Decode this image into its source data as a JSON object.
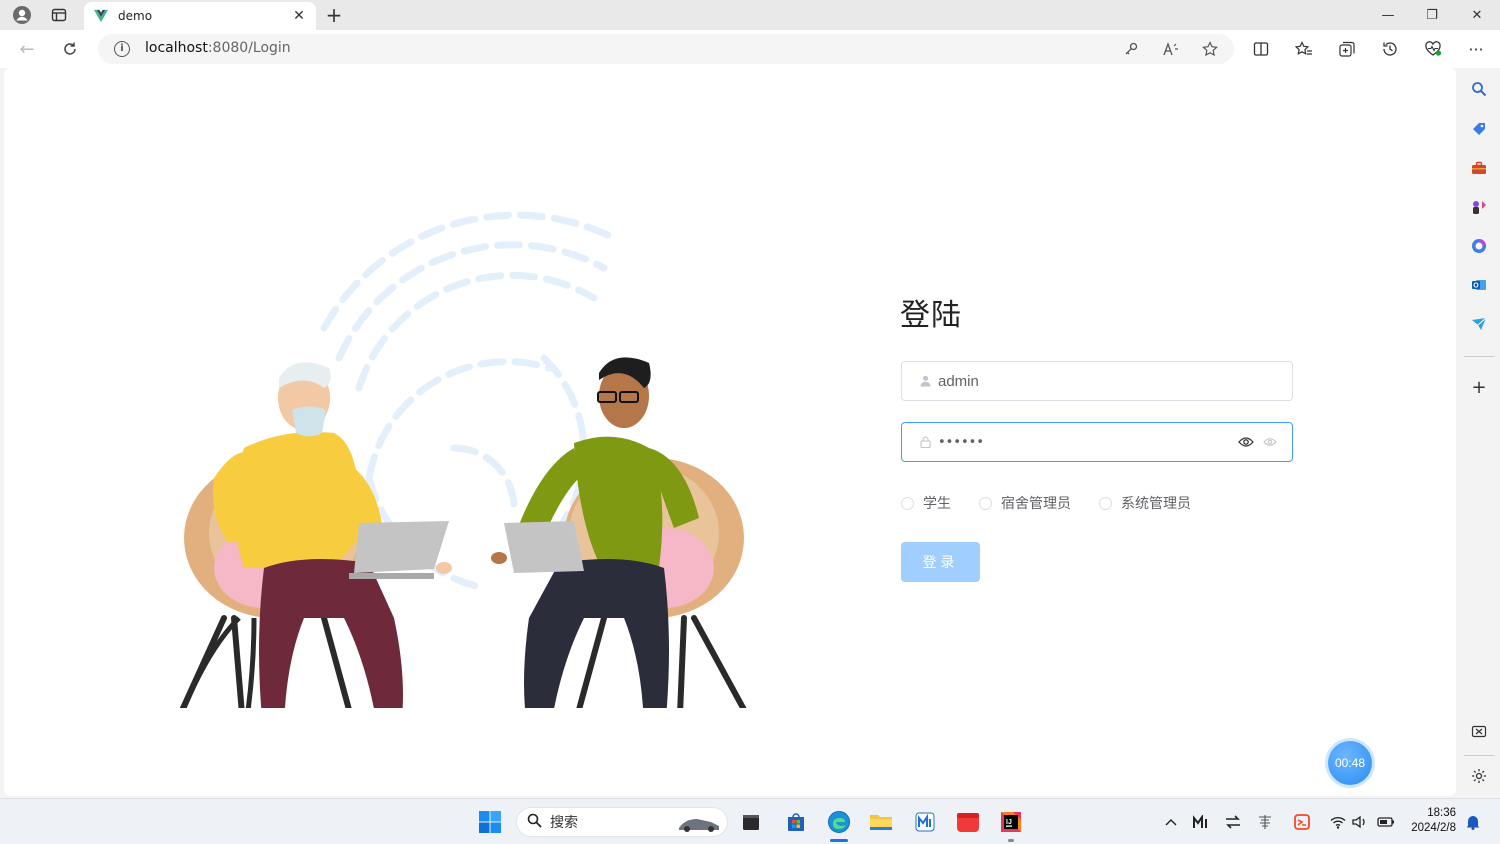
{
  "browser": {
    "tab_title": "demo",
    "url_host": "localhost",
    "url_rest": ":8080/Login",
    "new_tab_symbol": "+",
    "tab_close_symbol": "✕"
  },
  "window_controls": {
    "minimize": "—",
    "restore": "❐",
    "close": "✕"
  },
  "login": {
    "title": "登陆",
    "username_value": "admin",
    "password_value": "••••••",
    "roles": [
      {
        "label": "学生"
      },
      {
        "label": "宿舍管理员"
      },
      {
        "label": "系统管理员"
      }
    ],
    "submit_label": "登录"
  },
  "recorder": {
    "elapsed": "00:48"
  },
  "taskbar": {
    "search_placeholder": "搜索",
    "time": "18:36",
    "date": "2024/2/8"
  },
  "colors": {
    "primary_disabled": "#a0cfff",
    "focus_border": "#409eff",
    "input_border": "#dcdfe6"
  }
}
